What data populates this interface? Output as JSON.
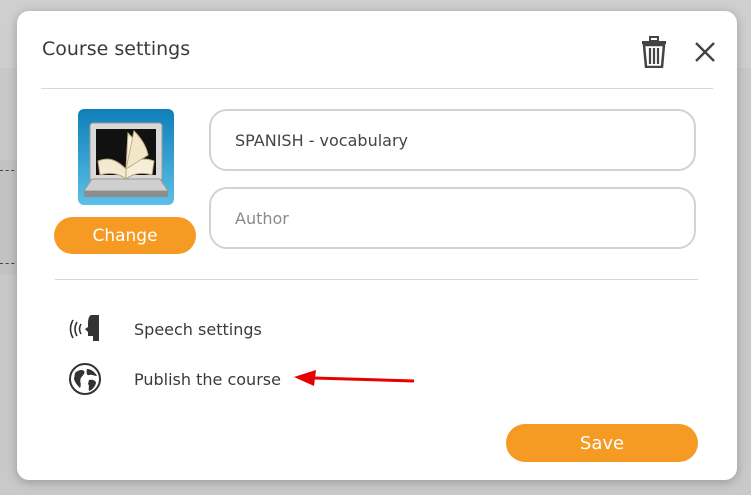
{
  "dialog": {
    "title": "Course settings",
    "change_label": "Change",
    "course_title_value": "SPANISH - vocabulary",
    "author_placeholder": "Author",
    "menu": [
      {
        "label": "Speech settings",
        "icon": "speech-icon"
      },
      {
        "label": "Publish the course",
        "icon": "globe-icon"
      }
    ],
    "save_label": "Save"
  },
  "colors": {
    "accent": "#f59a23",
    "annotation_arrow": "#e60000"
  }
}
